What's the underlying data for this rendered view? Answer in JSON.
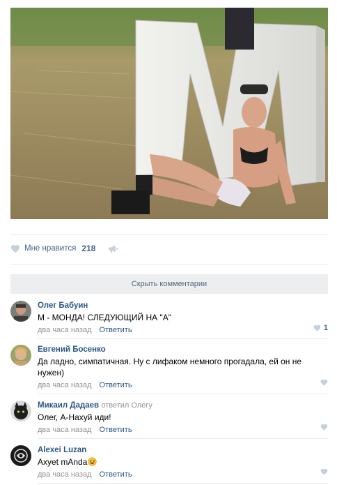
{
  "post": {
    "photo_description": "photo-outdoor-letter-m",
    "like_label": "Мне нравится",
    "like_count": "218"
  },
  "hide_comments_label": "Скрыть комментарии",
  "comments": [
    {
      "author": "Олег Бабуин",
      "text": "М - МОНДА! СЛЕДУЮЩИЙ НА \"А\"",
      "time": "два часа назад",
      "reply_label": "Ответить",
      "likes": "1"
    },
    {
      "author": "Евгений Босенко",
      "text": "Да ладно, симпатичная. Ну с лифаком немного прогадала, ей он не нужен)",
      "time": "два часа назад",
      "reply_label": "Ответить"
    },
    {
      "author": "Микаил Дадаев",
      "replied_to": "ответил Олегу",
      "text": "Олег, А-Нахуй иди!",
      "time": "два часа назад",
      "reply_label": "Ответить"
    },
    {
      "author": "Alexei Luzan",
      "text": "Axyet mAnda",
      "time": "два часа назад",
      "reply_label": "Ответить"
    }
  ],
  "colors": {
    "link": "#2a5885",
    "muted": "#939393",
    "like_blue": "#42648b",
    "heart_gray": "#c5d0db",
    "panel_bg": "#edeef0"
  }
}
